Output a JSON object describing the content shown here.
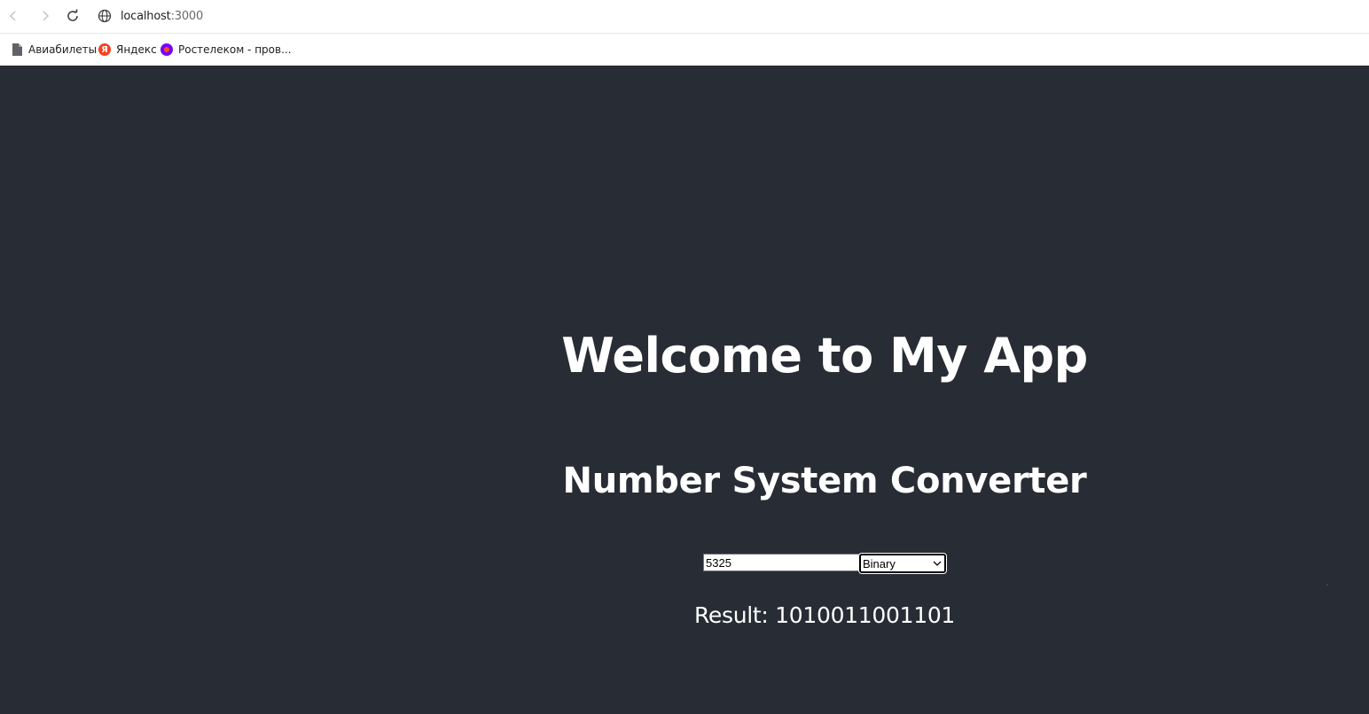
{
  "browser": {
    "url_host": "localhost",
    "url_port": ":3000",
    "bookmarks": [
      {
        "label": "Авиабилеты",
        "icon": "file-icon"
      },
      {
        "label": "Яндекс",
        "icon": "yandex-icon"
      },
      {
        "label": "Ростелеком - пров...",
        "icon": "rostelecom-icon"
      }
    ]
  },
  "app": {
    "title": "Welcome to My App",
    "subtitle": "Number System Converter",
    "input_value": "5325",
    "selected_base": "Binary",
    "result_label": "Result: ",
    "result_value": "1010011001101",
    "colors": {
      "background": "#282c34",
      "text": "#ffffff"
    }
  }
}
